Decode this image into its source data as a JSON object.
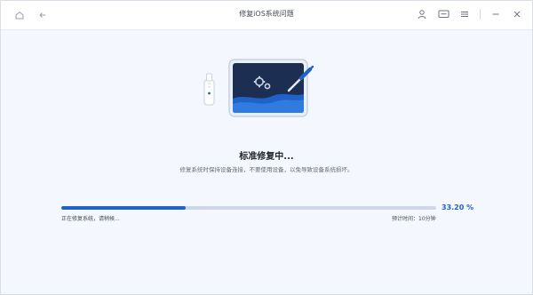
{
  "window": {
    "title": "修复iOS系统问题"
  },
  "icons": {
    "app_logo": "home-icon",
    "back": "arrow-left-icon",
    "user": "user-icon",
    "feedback": "message-icon",
    "menu": "menu-icon",
    "minimize": "minimize-icon",
    "close": "close-icon"
  },
  "status": {
    "title": "标准修复中...",
    "description": "修复系统时保持设备连接，不要使用设备，以免导致设备系统损坏。"
  },
  "progress": {
    "percent_label": "33.20 %",
    "value": 0.332,
    "status_text": "正在修复系统，请稍候...",
    "estimated_time": "预计时间：10分钟"
  },
  "colors": {
    "accent": "#1f62c8",
    "background": "#f4f7fd",
    "track": "#cfd7e6"
  }
}
